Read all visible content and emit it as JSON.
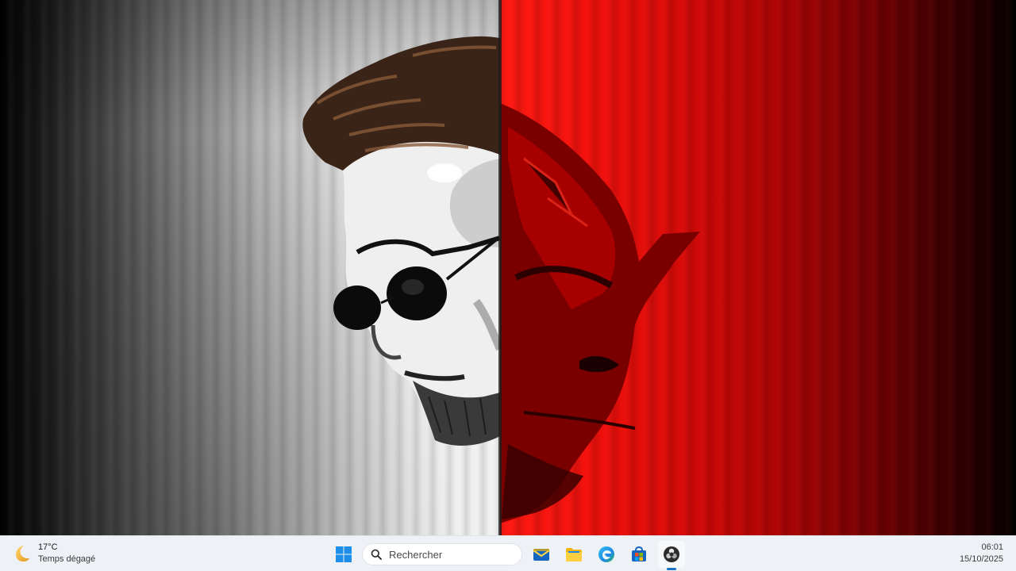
{
  "desktop": {
    "wallpaper": "split-portrait-man-and-red-masked-devil"
  },
  "colors": {
    "wallpaper_red": "#e3120b",
    "wallpaper_grey": "#d6d6d6",
    "taskbar_bg": "#eef1f6",
    "accent": "#1a73c8"
  },
  "taskbar": {
    "weather": {
      "icon": "moon-weather-icon",
      "temperature": "17°C",
      "condition": "Temps dégagé"
    },
    "start": {
      "icon": "windows-logo-icon"
    },
    "search": {
      "icon": "search-icon",
      "placeholder": "Rechercher"
    },
    "apps": [
      {
        "name": "mail-app",
        "icon": "mail-icon",
        "active": false
      },
      {
        "name": "file-explorer",
        "icon": "folder-icon",
        "active": false
      },
      {
        "name": "edge-browser",
        "icon": "edge-icon",
        "active": false
      },
      {
        "name": "microsoft-store",
        "icon": "store-icon",
        "active": false
      },
      {
        "name": "obs-studio",
        "icon": "obs-icon",
        "active": true
      }
    ],
    "clock": {
      "time": "06:01",
      "date": "15/10/2025"
    }
  }
}
